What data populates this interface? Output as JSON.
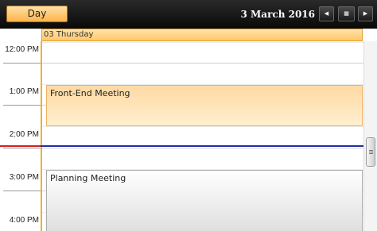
{
  "toolbar": {
    "view_label": "Day",
    "date_title": "3 March 2016",
    "prev_icon": "◀",
    "calendar_icon": "▦",
    "next_icon": "▶"
  },
  "day_header": {
    "label": "03 Thursday"
  },
  "time_labels": [
    "12:00 PM",
    "1:00 PM",
    "2:00 PM",
    "3:00 PM",
    "4:00 PM"
  ],
  "appointments": [
    {
      "title": "Front-End Meeting"
    },
    {
      "title": "Planning Meeting"
    }
  ],
  "colors": {
    "accent": "#ffb347",
    "current_time_line": "#1f2fa0",
    "current_time_marker": "#d02020"
  }
}
